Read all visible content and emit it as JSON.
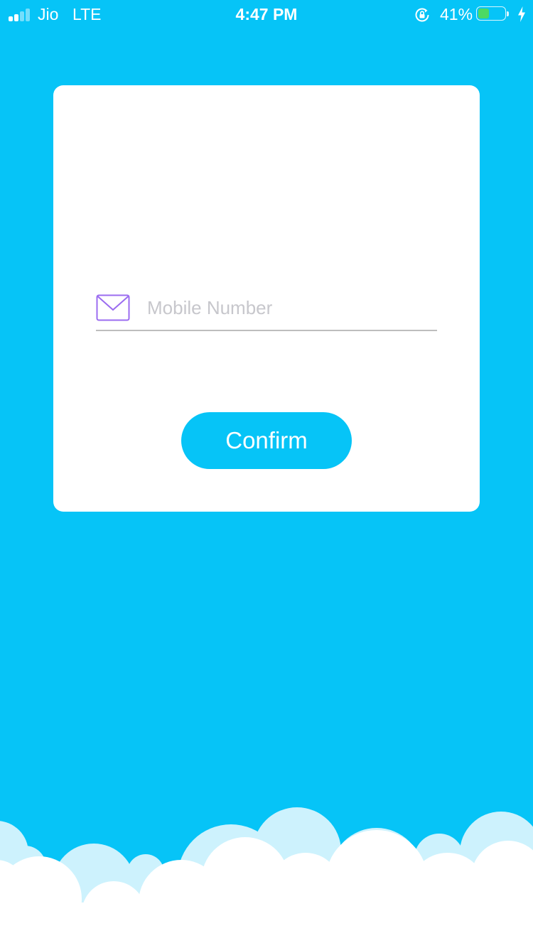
{
  "status_bar": {
    "carrier": "Jio",
    "network": "LTE",
    "time": "4:47 PM",
    "battery_percent": "41%",
    "battery_level": 0.41,
    "battery_color": "#4cd964",
    "icons": [
      "signal-bars-icon",
      "rotation-lock-icon",
      "battery-icon",
      "charging-bolt-icon"
    ]
  },
  "form": {
    "field_icon": "mail-icon",
    "field_icon_color": "#9b6cf0",
    "phone_placeholder": "Mobile Number",
    "phone_value": "",
    "confirm_label": "Confirm"
  },
  "theme": {
    "background": "#06c4f7",
    "card": "#ffffff",
    "button": "#06c4f7",
    "cloud_light": "#cdf2fd",
    "cloud_white": "#ffffff"
  }
}
